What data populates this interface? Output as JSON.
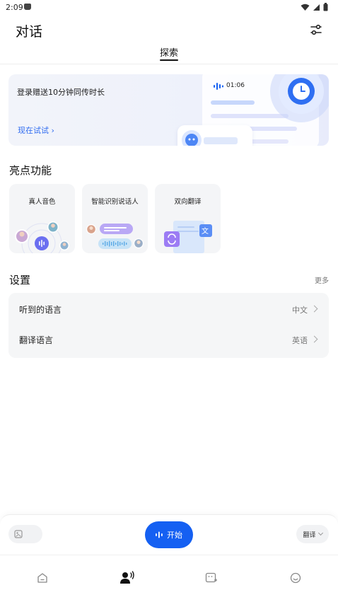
{
  "status_bar": {
    "time": "2:09"
  },
  "header": {
    "title": "对话",
    "tab": "探索"
  },
  "banner": {
    "text": "登录赠送10分钟同传时长",
    "link": "现在试试 ›",
    "timer": "01:06"
  },
  "highlights": {
    "title": "亮点功能",
    "cards": [
      {
        "label": "真人音色"
      },
      {
        "label": "智能识别说话人"
      },
      {
        "label": "双向翻译"
      }
    ]
  },
  "settings": {
    "title": "设置",
    "more": "更多",
    "rows": [
      {
        "label": "听到的语言",
        "value": "中文"
      },
      {
        "label": "翻译语言",
        "value": "英语"
      }
    ]
  },
  "control_bar": {
    "start_label": "开始",
    "mode_label": "翻译"
  },
  "colors": {
    "accent": "#1560f2",
    "link": "#2e6bf0"
  },
  "nav_items": [
    "home-icon",
    "conversation-icon",
    "add-screen-icon",
    "profile-icon"
  ]
}
